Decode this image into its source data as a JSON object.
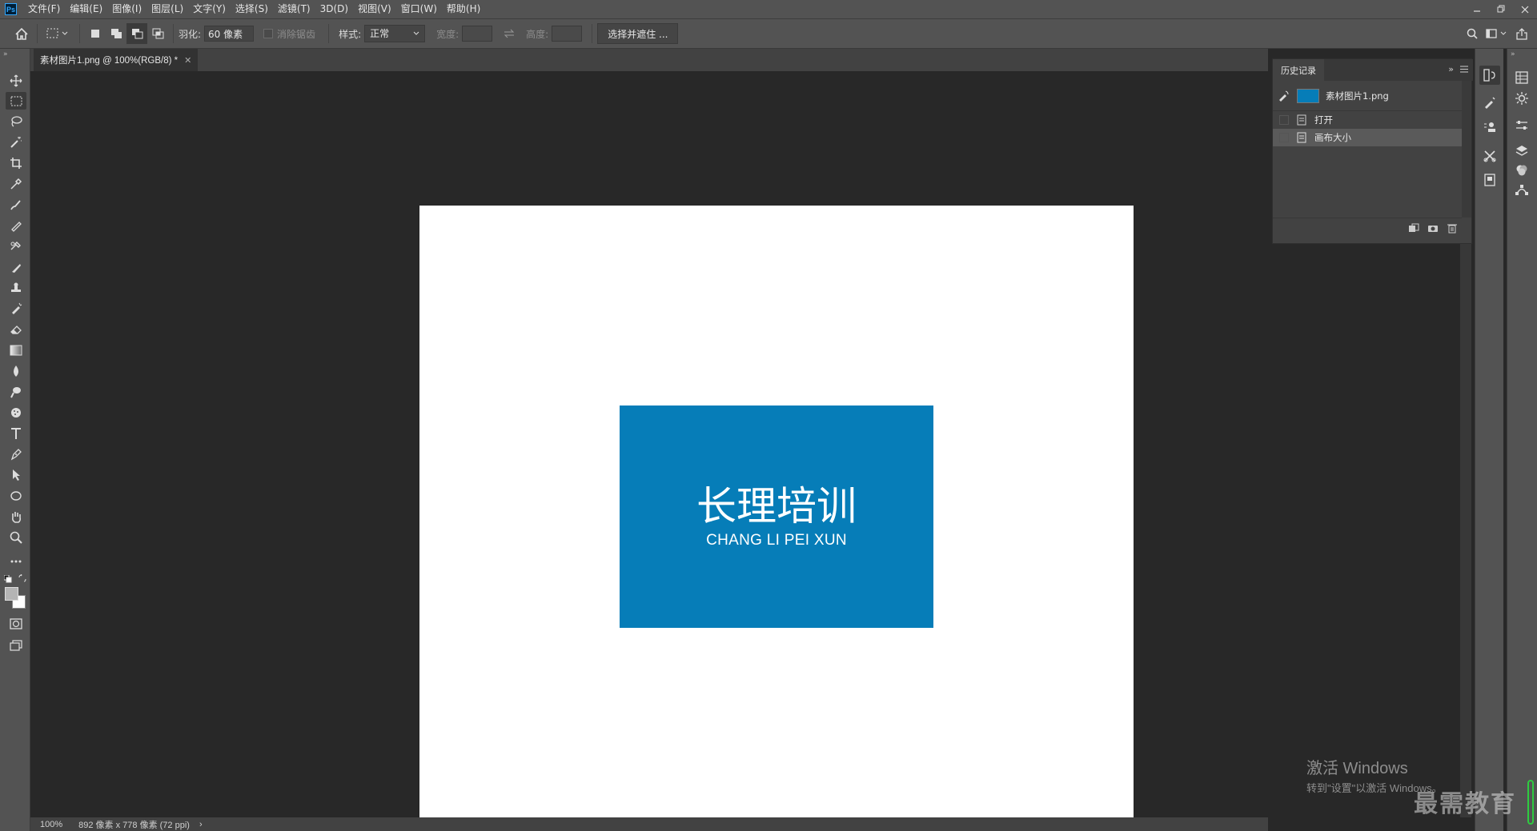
{
  "app": {
    "logo_text": "Ps",
    "menus": [
      "文件(F)",
      "编辑(E)",
      "图像(I)",
      "图层(L)",
      "文字(Y)",
      "选择(S)",
      "滤镜(T)",
      "3D(D)",
      "视图(V)",
      "窗口(W)",
      "帮助(H)"
    ]
  },
  "options_bar": {
    "feather_label": "羽化:",
    "feather_value": "60 像素",
    "antialias_label": "消除锯齿",
    "style_label": "样式:",
    "style_value": "正常",
    "width_label": "宽度:",
    "height_label": "高度:",
    "select_mask_label": "选择并遮住 ..."
  },
  "document": {
    "tab_title": "素材图片1.png @ 100%(RGB/8) *",
    "canvas_color": "#ffffff",
    "logo_bg": "#067db8",
    "logo_title_cn": "长理培训",
    "logo_title_en": "CHANG LI PEI XUN"
  },
  "history_panel": {
    "tab_label": "历史记录",
    "snapshot_label": "素材图片1.png",
    "states": [
      {
        "label": "打开",
        "selected": false
      },
      {
        "label": "画布大小",
        "selected": true
      }
    ]
  },
  "status_bar": {
    "zoom": "100%",
    "doc_info": "892 像素 x 778 像素 (72 ppi)",
    "arrow": "›"
  },
  "watermarks": {
    "activate_title": "激活 Windows",
    "activate_sub": "转到\"设置\"以激活 Windows。",
    "brand": "最需教育"
  }
}
